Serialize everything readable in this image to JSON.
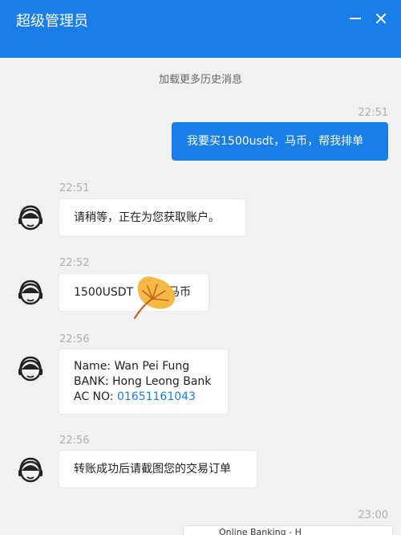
{
  "header": {
    "title": "超级管理员"
  },
  "load_more": "加载更多历史消息",
  "messages": [
    {
      "time": "22:51",
      "direction": "outgoing",
      "text": "我要买1500usdt，马币，帮我排单"
    },
    {
      "time": "22:51",
      "direction": "incoming",
      "text": "请稍等，正在为您获取账户。"
    },
    {
      "time": "22:52",
      "direction": "incoming",
      "text_before": "1500USDT",
      "text_after": "马币",
      "sticker_icon": "ginkgo-leaf-icon"
    },
    {
      "time": "22:56",
      "direction": "incoming",
      "lines": [
        "Name: Wan Pei Fung",
        "BANK: Hong Leong Bank"
      ],
      "ac_label": "AC NO: ",
      "ac_number": "01651161043"
    },
    {
      "time": "22:56",
      "direction": "incoming",
      "text": "转账成功后请截图您的交易订单"
    },
    {
      "time": "23:00",
      "direction": "outgoing",
      "preview_text": "Online Banking - H"
    }
  ],
  "colors": {
    "header": "#1a7ee8",
    "outgoing_bubble": "#1a7ee8",
    "background": "#f1f1f1",
    "link": "#1a7ee8"
  },
  "icons": {
    "minimize": "minimize-icon",
    "close": "close-icon",
    "avatar": "support-agent-avatar-icon"
  }
}
